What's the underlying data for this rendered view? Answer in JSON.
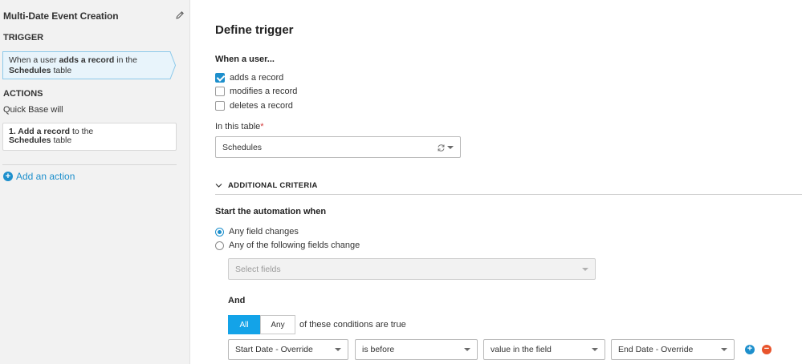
{
  "sidebar": {
    "app_title": "Multi-Date Event Creation",
    "trigger_heading": "TRIGGER",
    "trigger_card": {
      "prefix": "When a user ",
      "action": "adds a record",
      "mid": " in the ",
      "table": "Schedules",
      "suffix": " table"
    },
    "actions_heading": "ACTIONS",
    "actions_sub": "Quick Base will",
    "action_card": {
      "prefix": "1. ",
      "action": "Add a record",
      "mid": " to the",
      "table": "Schedules",
      "suffix": " table"
    },
    "add_action_label": "Add an action"
  },
  "main": {
    "title": "Define trigger",
    "when_label": "When a user...",
    "events": [
      {
        "label": "adds a record",
        "checked": true
      },
      {
        "label": "modifies a record",
        "checked": false
      },
      {
        "label": "deletes a record",
        "checked": false
      }
    ],
    "table_label": "In this table",
    "required_mark": "*",
    "table_value": "Schedules",
    "criteria_label": "ADDITIONAL CRITERIA",
    "start_label": "Start the automation when",
    "start_options": [
      {
        "label": "Any field changes",
        "selected": true
      },
      {
        "label": "Any of the following fields change",
        "selected": false
      }
    ],
    "select_fields_placeholder": "Select fields",
    "and_label": "And",
    "match_options": [
      "All",
      "Any"
    ],
    "match_selected": "All",
    "match_text": "of these conditions are true",
    "condition": {
      "field": "Start Date - Override",
      "operator": "is before",
      "compare_type": "value in the field",
      "compare_field": "End Date - Override"
    }
  },
  "colors": {
    "accent": "#1d8fcc",
    "segment_active": "#13a3e8",
    "remove": "#e8542c"
  }
}
